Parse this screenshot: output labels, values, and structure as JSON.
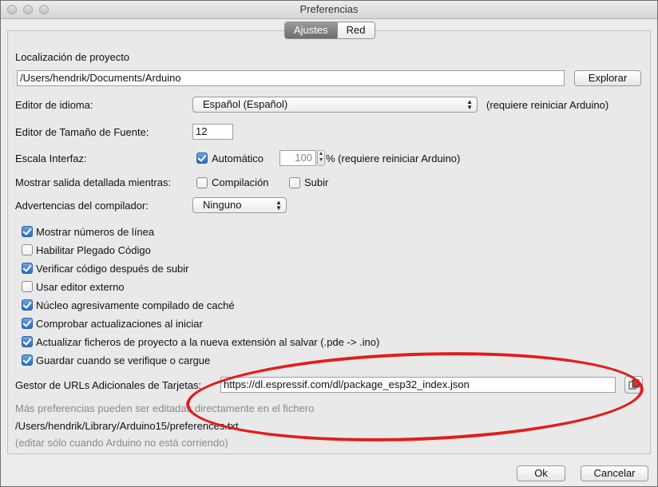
{
  "window": {
    "title": "Preferencias"
  },
  "tabs": [
    {
      "label": "Ajustes",
      "active": true
    },
    {
      "label": "Red",
      "active": false
    }
  ],
  "location": {
    "label": "Localización de proyecto",
    "path": "/Users/hendrik/Documents/Arduino",
    "browse_label": "Explorar"
  },
  "language": {
    "label": "Editor de idioma:",
    "selected": "Español (Español)",
    "note": "(requiere reiniciar Arduino)"
  },
  "font_size": {
    "label": "Editor de Tamaño de Fuente:",
    "value": "12"
  },
  "scale": {
    "label": "Escala Interfaz:",
    "auto_label": "Automático",
    "auto_checked": true,
    "value": "100",
    "percent_note": "% (requiere reiniciar Arduino)"
  },
  "verbose": {
    "label": "Mostrar salida detallada mientras:",
    "compile_label": "Compilación",
    "compile_checked": false,
    "upload_label": "Subir",
    "upload_checked": false
  },
  "warnings": {
    "label": "Advertencias del compilador:",
    "selected": "Ninguno"
  },
  "options": [
    {
      "label": "Mostrar números de línea",
      "checked": true
    },
    {
      "label": "Habilitar Plegado Código",
      "checked": false
    },
    {
      "label": "Verificar código después de subir",
      "checked": true
    },
    {
      "label": "Usar editor externo",
      "checked": false
    },
    {
      "label": "Núcleo agresivamente compilado de caché",
      "checked": true
    },
    {
      "label": "Comprobar actualizaciones al iniciar",
      "checked": true
    },
    {
      "label": "Actualizar ficheros de proyecto a la nueva extensión al salvar (.pde -> .ino)",
      "checked": true
    },
    {
      "label": "Guardar cuando se verifique o cargue",
      "checked": true
    }
  ],
  "board_urls": {
    "label": "Gestor de URLs Adicionales de Tarjetas:",
    "value": "https://dl.espressif.com/dl/package_esp32_index.json"
  },
  "more_prefs": {
    "note": "Más preferencias pueden ser editadas directamente en el fichero",
    "path": "/Users/hendrik/Library/Arduino15/preferences.txt",
    "hint": "(editar sólo cuando Arduino no está corriendo)"
  },
  "footer": {
    "ok_label": "Ok",
    "cancel_label": "Cancelar"
  },
  "colors": {
    "annotation_ellipse": "#e01e1e",
    "checkbox_checked": "#2a6dc0"
  }
}
